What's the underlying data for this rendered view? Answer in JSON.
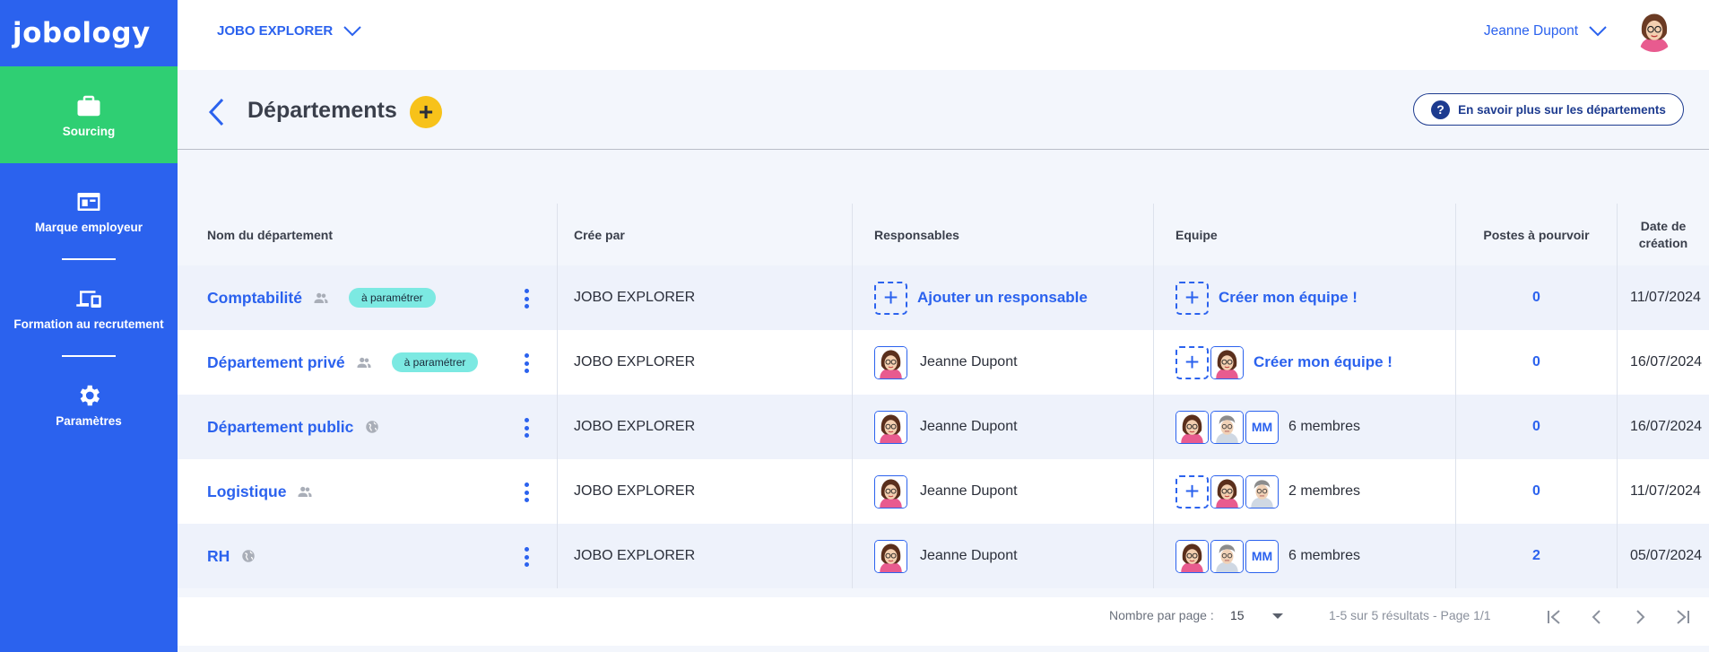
{
  "logo": {
    "text": "jobology"
  },
  "sidebar": {
    "items": [
      {
        "label": "Sourcing",
        "icon": "briefcase-icon",
        "active": true
      },
      {
        "label": "Marque employeur",
        "icon": "window-card-icon"
      },
      {
        "label": "Formation au recrutement",
        "icon": "devices-icon"
      },
      {
        "label": "Paramètres",
        "icon": "gear-icon"
      }
    ]
  },
  "topbar": {
    "company": "JOBO EXPLORER",
    "user": "Jeanne Dupont"
  },
  "page": {
    "title": "Départements",
    "add_label": "+",
    "help_label": "En savoir plus sur les départements",
    "help_icon": "?"
  },
  "table": {
    "headers": {
      "name": "Nom du département",
      "created_by": "Crée par",
      "managers": "Responsables",
      "team": "Equipe",
      "positions": "Postes à pourvoir",
      "date": "Date de création"
    },
    "add_manager_label": "Ajouter un responsable",
    "create_team_label": "Créer mon équipe !",
    "rows": [
      {
        "name": "Comptabilité",
        "visibility": "people-icon",
        "badge": "à paramétrer",
        "created_by": "JOBO EXPLORER",
        "manager": "",
        "team_members": "",
        "mm": "",
        "positions": "0",
        "date": "11/07/2024"
      },
      {
        "name": "Département privé",
        "visibility": "people-icon",
        "badge": "à paramétrer",
        "created_by": "JOBO EXPLORER",
        "manager": "Jeanne Dupont",
        "team_members": "",
        "mm": "",
        "positions": "0",
        "date": "16/07/2024"
      },
      {
        "name": "Département public",
        "visibility": "globe-icon",
        "badge": "",
        "created_by": "JOBO EXPLORER",
        "manager": "Jeanne Dupont",
        "team_members": "6 membres",
        "mm": "MM",
        "positions": "0",
        "date": "16/07/2024"
      },
      {
        "name": "Logistique",
        "visibility": "people-icon",
        "badge": "",
        "created_by": "JOBO EXPLORER",
        "manager": "Jeanne Dupont",
        "team_members": "2 membres",
        "mm": "",
        "positions": "0",
        "date": "11/07/2024"
      },
      {
        "name": "RH",
        "visibility": "globe-icon",
        "badge": "",
        "created_by": "JOBO EXPLORER",
        "manager": "Jeanne Dupont",
        "team_members": "6 membres",
        "mm": "MM",
        "positions": "2",
        "date": "05/07/2024"
      }
    ]
  },
  "pagination": {
    "per_page_label": "Nombre par page :",
    "per_page_value": "15",
    "info": "1-5 sur 5 résultats - Page 1/1"
  },
  "colors": {
    "primary": "#2b62ee",
    "sidebar_active": "#2fcf73",
    "accent_yellow": "#f7c21a",
    "badge": "#7ce9e2",
    "help_border": "#1d3b8f"
  }
}
